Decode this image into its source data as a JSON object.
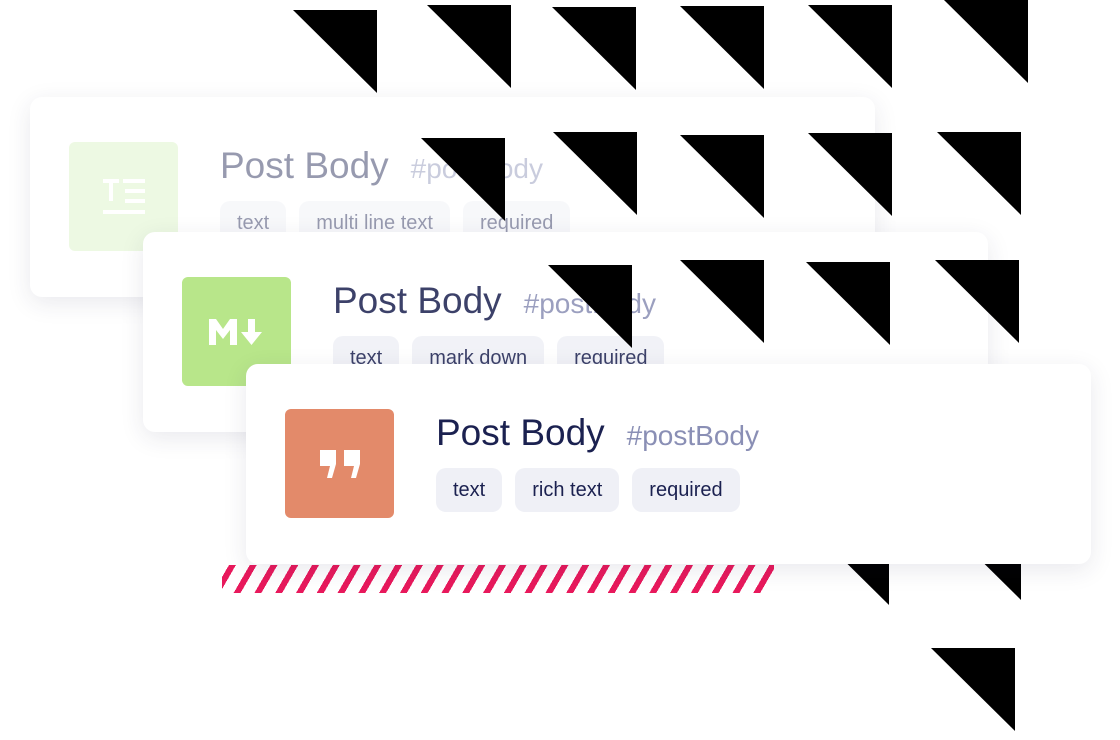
{
  "colors": {
    "text_icon_bg": "#d9f2c2",
    "markdown_icon_bg": "#b8e68a",
    "richtext_icon_bg": "#e38a6a",
    "stripe": "#e8195c",
    "tag_bg": "#eff0f6"
  },
  "cards": [
    {
      "icon": "text-lines-icon",
      "title": "Post Body",
      "api_id": "#postBody",
      "tags": [
        "text",
        "multi line text",
        "required"
      ]
    },
    {
      "icon": "markdown-icon",
      "title": "Post Body",
      "api_id": "#postBody",
      "tags": [
        "text",
        "mark down",
        "required"
      ]
    },
    {
      "icon": "quote-icon",
      "title": "Post Body",
      "api_id": "#postBody",
      "tags": [
        "text",
        "rich text",
        "required"
      ]
    }
  ]
}
